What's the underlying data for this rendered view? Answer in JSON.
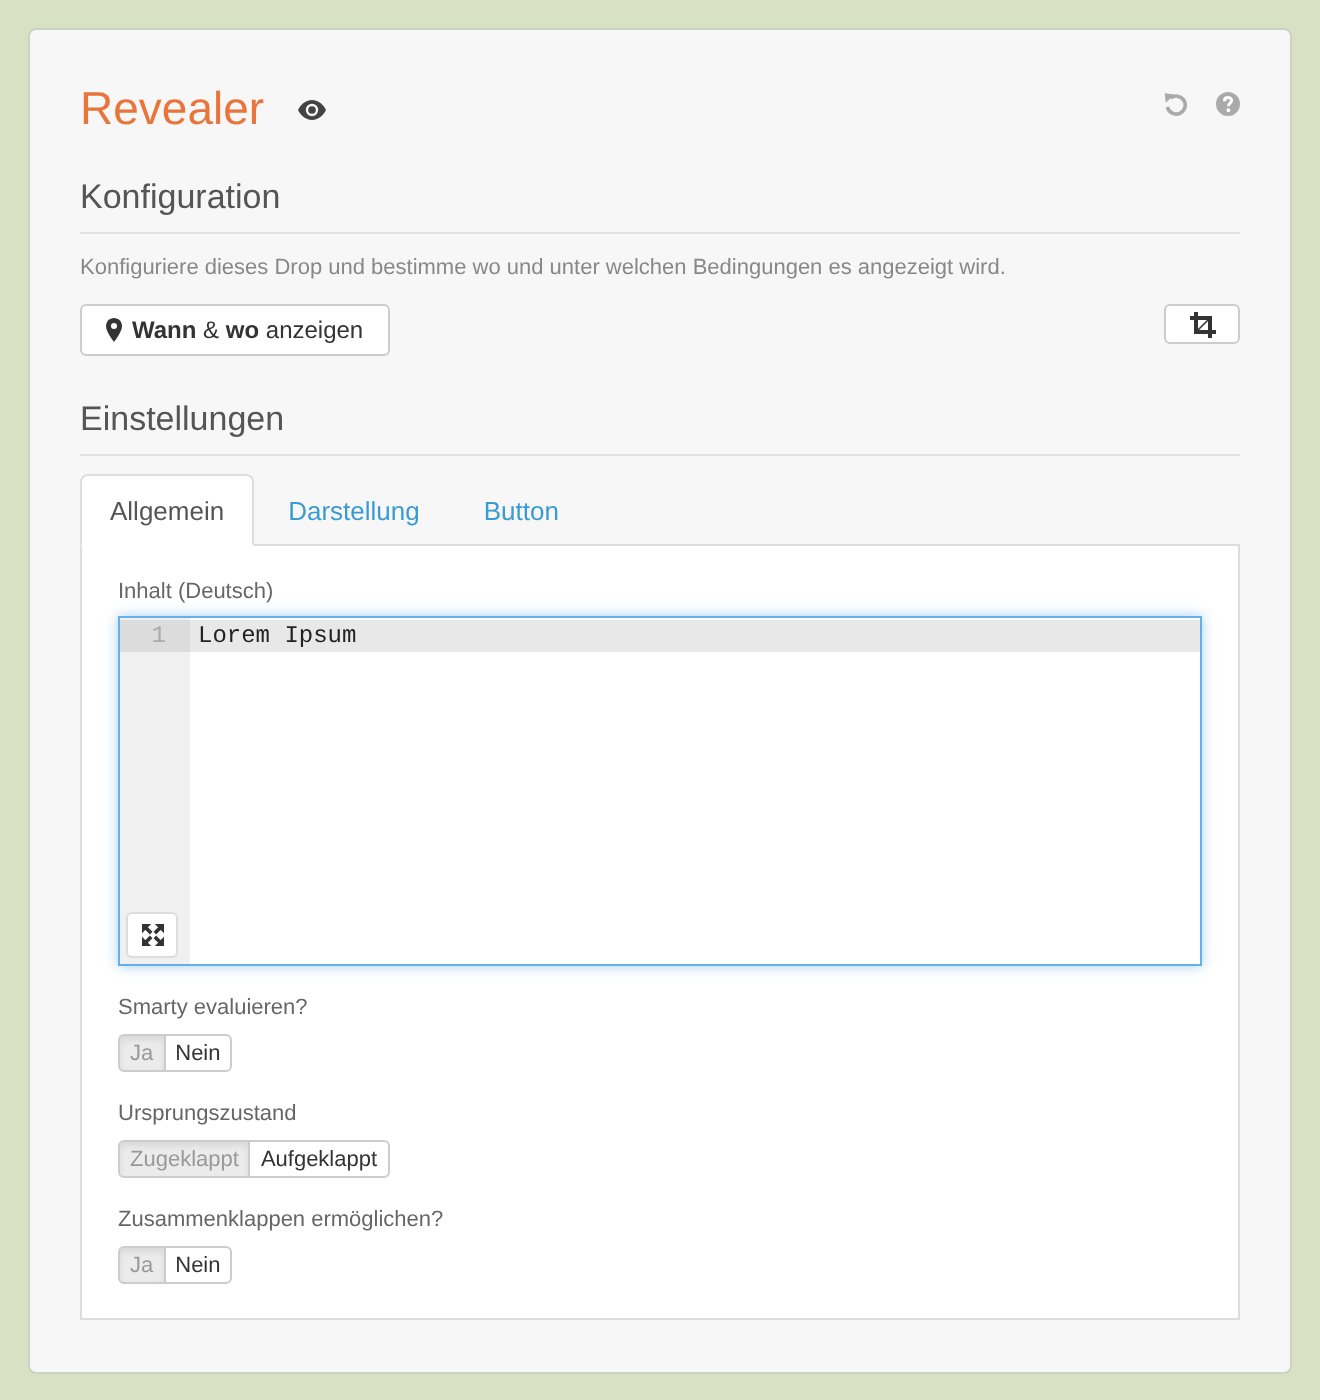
{
  "title": "Revealer",
  "configuration": {
    "heading": "Konfiguration",
    "description": "Konfiguriere dieses Drop und bestimme wo und unter welchen Bedingungen es angezeigt wird.",
    "display_rules_button": "**Wann** & **wo** anzeigen"
  },
  "settings": {
    "heading": "Einstellungen",
    "tabs": [
      {
        "label": "Allgemein",
        "selected": true
      },
      {
        "label": "Darstellung",
        "selected": false
      },
      {
        "label": "Button",
        "selected": false
      }
    ],
    "content_field": {
      "label": "Inhalt (Deutsch)",
      "focused": true,
      "lines": [
        {
          "number": "1",
          "text": "Lorem Ipsum",
          "active": true
        }
      ]
    },
    "options": [
      {
        "label": "Smarty evaluieren?",
        "choices": [
          {
            "label": "Ja",
            "selected": true
          },
          {
            "label": "Nein",
            "selected": false
          }
        ]
      },
      {
        "label": "Ursprungszustand",
        "choices": [
          {
            "label": "Zugeklappt",
            "selected": true
          },
          {
            "label": "Aufgeklappt",
            "selected": false
          }
        ]
      },
      {
        "label": "Zusammenklappen ermöglichen?",
        "choices": [
          {
            "label": "Ja",
            "selected": true
          },
          {
            "label": "Nein",
            "selected": false
          }
        ]
      }
    ]
  }
}
